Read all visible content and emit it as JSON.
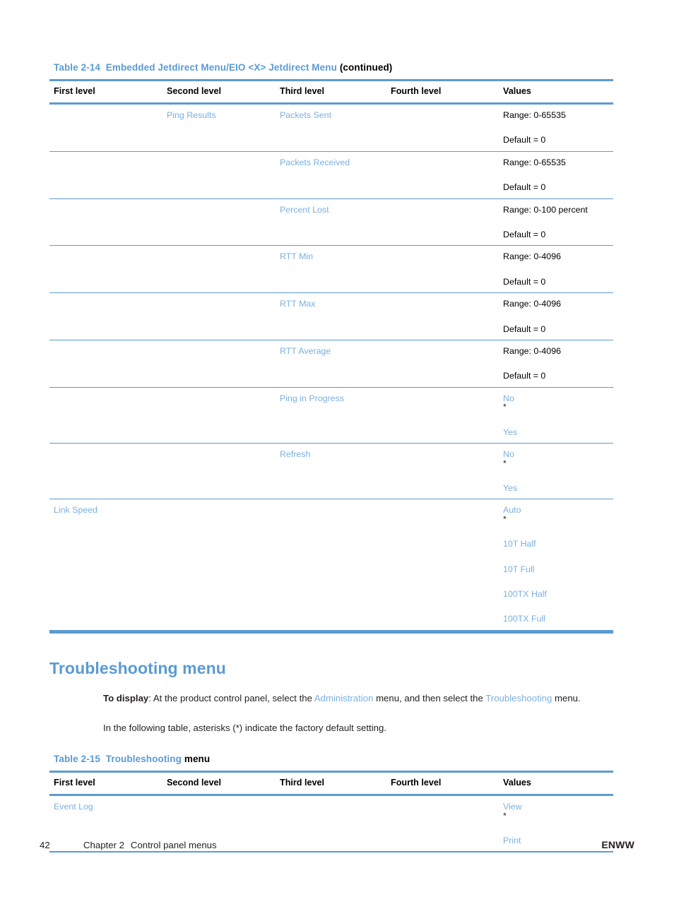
{
  "document": {
    "page_number": "42",
    "chapter": "Chapter 2",
    "chapter_title": "Control panel menus",
    "publisher_mark": "ENWW"
  },
  "table_jetdirect": {
    "caption_prefix": "Table 2-14",
    "caption_link_a": "Embedded Jetdirect Menu",
    "caption_separator": "/",
    "caption_link_b": "EIO <X> Jetdirect Menu",
    "caption_suffix": "(continued)",
    "columns": [
      "First level",
      "Second level",
      "Third level",
      "Fourth level",
      "Values"
    ],
    "rows": [
      {
        "first": "",
        "second": "Ping Results",
        "third": "Packets Sent",
        "fourth": "",
        "values": [
          "Range: 0-65535",
          "Default = 0"
        ],
        "values_plain": true
      },
      {
        "first": "",
        "second": "",
        "third": "Packets Received",
        "fourth": "",
        "values": [
          "Range: 0-65535",
          "Default = 0"
        ],
        "values_plain": true
      },
      {
        "first": "",
        "second": "",
        "third": "Percent Lost",
        "fourth": "",
        "values": [
          "Range: 0-100 percent",
          "Default = 0"
        ],
        "values_plain": true
      },
      {
        "first": "",
        "second": "",
        "third": "RTT Min",
        "fourth": "",
        "values": [
          "Range: 0-4096",
          "Default = 0"
        ],
        "values_plain": true
      },
      {
        "first": "",
        "second": "",
        "third": "RTT Max",
        "fourth": "",
        "values": [
          "Range: 0-4096",
          "Default = 0"
        ],
        "values_plain": true
      },
      {
        "first": "",
        "second": "",
        "third": "RTT Average",
        "fourth": "",
        "values": [
          "Range: 0-4096",
          "Default = 0"
        ],
        "values_plain": true
      },
      {
        "first": "",
        "second": "",
        "third": "Ping in Progress",
        "fourth": "",
        "values": [
          "No*",
          "Yes"
        ],
        "values_plain": false
      },
      {
        "first": "",
        "second": "",
        "third": "Refresh",
        "fourth": "",
        "values": [
          "No*",
          "Yes"
        ],
        "values_plain": false
      },
      {
        "first": "Link Speed",
        "second": "",
        "third": "",
        "fourth": "",
        "values": [
          "Auto*",
          "10T Half",
          "10T Full",
          "100TX Half",
          "100TX Full"
        ],
        "values_plain": false
      }
    ]
  },
  "section": {
    "heading": "Troubleshooting menu",
    "paragraph1": {
      "bold_lead": "To display",
      "part1": ": At the product control panel, select the ",
      "link1": "Administration",
      "part2": " menu, and then select the ",
      "link2": "Troubleshooting",
      "part3": " menu."
    },
    "paragraph2": "In the following table, asterisks (*) indicate the factory default setting."
  },
  "table_troubleshooting": {
    "caption_prefix": "Table 2-15",
    "caption_link_a": "Troubleshooting",
    "caption_suffix": "menu",
    "columns": [
      "First level",
      "Second level",
      "Third level",
      "Fourth level",
      "Values"
    ],
    "rows": [
      {
        "first": "Event Log",
        "second": "",
        "third": "",
        "fourth": "",
        "values": [
          "View*",
          "Print"
        ],
        "values_plain": false
      }
    ]
  },
  "colors": {
    "heading_blue": "#5b9bd1",
    "link_blue": "#7bb0e0",
    "rule_blue": "#5b9bd1",
    "text_black": "#231f20"
  }
}
